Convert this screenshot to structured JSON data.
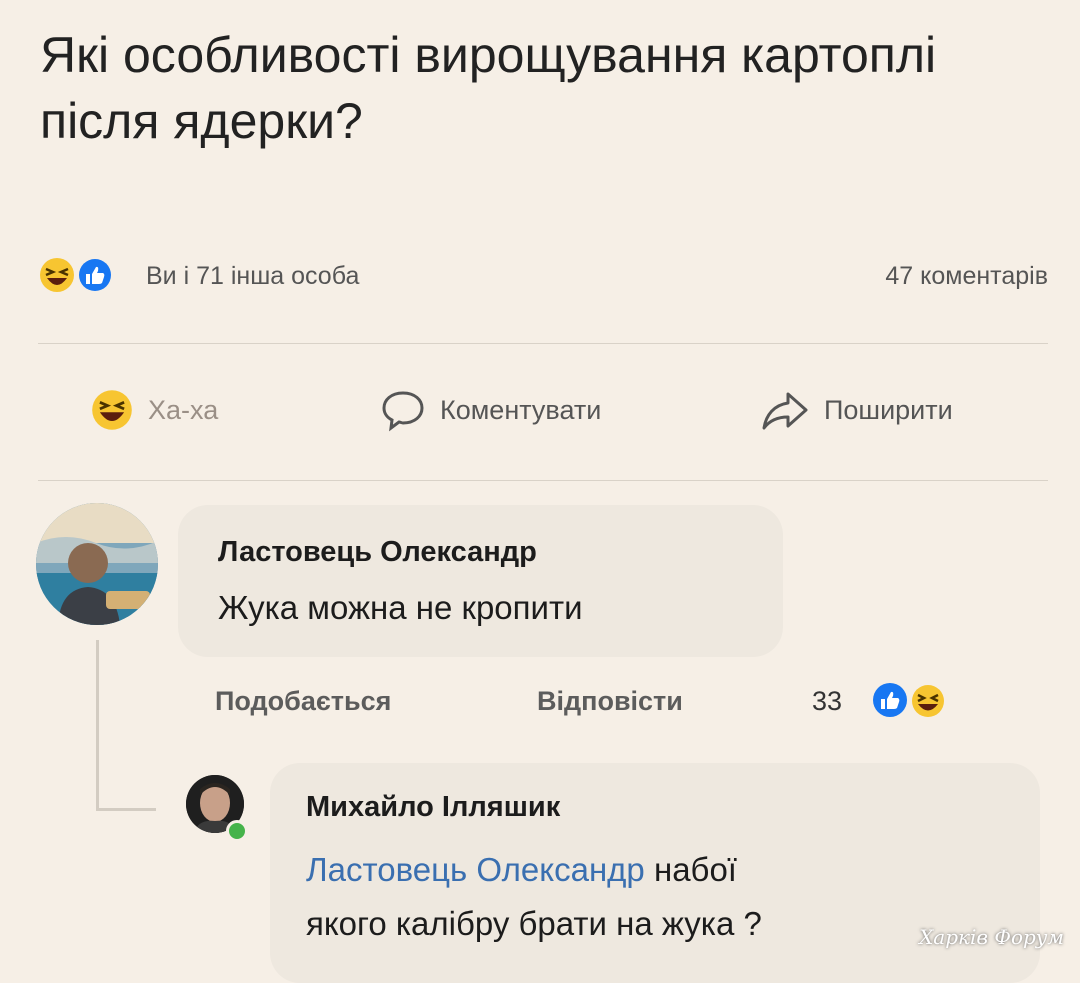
{
  "post": {
    "title": "Які особливості вирощування картоплі після ядерки?",
    "reactions_text": "Ви і 71 інша особа",
    "comments_count_text": "47 коментарів",
    "reaction_icons": [
      "haha-emoji-icon",
      "like-thumb-icon"
    ]
  },
  "actions": {
    "haha_label": "Ха-ха",
    "comment_label": "Коментувати",
    "share_label": "Поширити"
  },
  "comments": [
    {
      "author": "Ластовець Олександр",
      "text": "Жука можна не кропити",
      "like_label": "Подобається",
      "reply_label": "Відповісти",
      "reaction_count": "33",
      "reaction_icons": [
        "like-thumb-icon",
        "haha-emoji-icon"
      ]
    }
  ],
  "reply": {
    "author": "Михайло Ілляшик",
    "mention": "Ластовець Олександр",
    "text_after_mention": " набої",
    "text_line2": "якого калібру брати на жука ?",
    "online": true
  },
  "watermark": "Харків Форум",
  "colors": {
    "background": "#f6efe6",
    "bubble": "#eee8df",
    "mention": "#3a6fb0",
    "like_blue": "#1877f2",
    "haha_yellow": "#f7c531"
  }
}
